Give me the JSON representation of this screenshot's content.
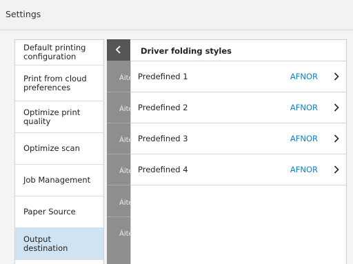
{
  "window": {
    "title": "Settings"
  },
  "sidebar": {
    "items": [
      {
        "label": "Default printing configuration",
        "selected": false
      },
      {
        "label": "Print from cloud preferences",
        "selected": false
      },
      {
        "label": "Optimize print quality",
        "selected": false
      },
      {
        "label": "Optimize scan",
        "selected": false
      },
      {
        "label": "Job Management",
        "selected": false
      },
      {
        "label": "Paper Source",
        "selected": false
      },
      {
        "label": "Output destination",
        "selected": true
      }
    ]
  },
  "middle_strip": {
    "items": [
      "Áite",
      "Áite",
      "Áite",
      "Áite",
      "Áite",
      "Áite"
    ]
  },
  "panel": {
    "title": "Driver folding styles",
    "rows": [
      {
        "label": "Predefined 1",
        "value": "AFNOR"
      },
      {
        "label": "Predefined 2",
        "value": "AFNOR"
      },
      {
        "label": "Predefined 3",
        "value": "AFNOR"
      },
      {
        "label": "Predefined 4",
        "value": "AFNOR"
      }
    ]
  },
  "colors": {
    "accent": "#0f7fc8",
    "selected_bg": "#cfe3f2",
    "strip": "#8e8e8e",
    "back_tab": "#555555"
  },
  "icons": {
    "back": "chevron-left-icon",
    "row": "chevron-right-icon"
  }
}
